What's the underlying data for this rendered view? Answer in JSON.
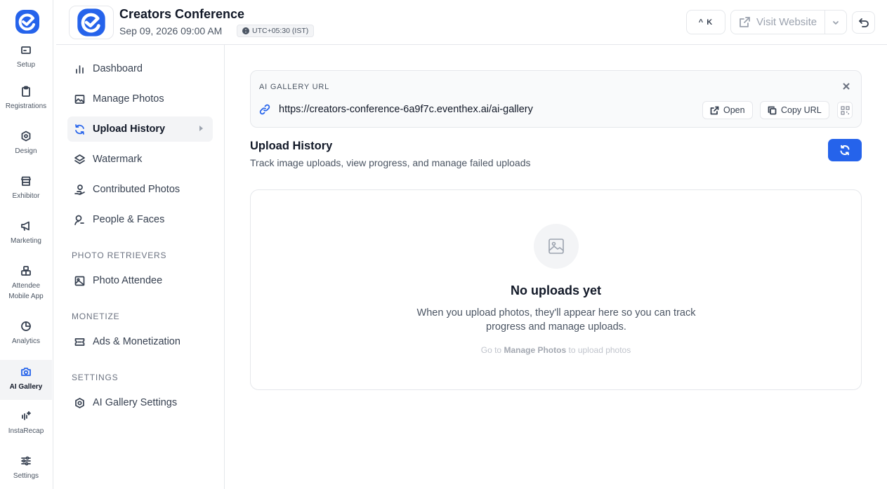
{
  "rail": {
    "items": [
      {
        "label": "Setup",
        "icon": "setup-icon"
      },
      {
        "label": "Registrations",
        "icon": "clipboard-icon"
      },
      {
        "label": "Design",
        "icon": "design-icon"
      },
      {
        "label": "Exhibitor",
        "icon": "store-icon"
      },
      {
        "label": "Marketing",
        "icon": "megaphone-icon"
      },
      {
        "label_line1": "Attendee",
        "label_line2": "Mobile App",
        "icon": "app-icon"
      },
      {
        "label": "Analytics",
        "icon": "pie-chart-icon"
      },
      {
        "label": "AI Gallery",
        "icon": "camera-icon",
        "active": true
      },
      {
        "label": "InstaRecap",
        "icon": "sparkle-audio-icon"
      },
      {
        "label": "Settings",
        "icon": "sliders-icon"
      }
    ]
  },
  "header": {
    "event_title": "Creators Conference",
    "event_date": "Sep 09, 2026 09:00 AM",
    "timezone": "UTC+05:30 (IST)",
    "shortcut_label": "^ K",
    "visit_label": "Visit Website"
  },
  "subnav": {
    "items": [
      {
        "label": "Dashboard",
        "icon": "bar-chart-icon"
      },
      {
        "label": "Manage Photos",
        "icon": "image-icon"
      },
      {
        "label": "Upload History",
        "icon": "refresh-icon",
        "active": true
      },
      {
        "label": "Watermark",
        "icon": "layers-icon"
      },
      {
        "label": "Contributed Photos",
        "icon": "hand-icon"
      },
      {
        "label": "People & Faces",
        "icon": "person-search-icon"
      }
    ],
    "section_retrievers": "PHOTO RETRIEVERS",
    "photo_attendee": "Photo Attendee",
    "section_monetize": "MONETIZE",
    "ads": "Ads & Monetization",
    "section_settings": "SETTINGS",
    "gallery_settings": "AI Gallery Settings"
  },
  "url_card": {
    "label": "AI GALLERY URL",
    "url": "https://creators-conference-6a9f7c.eventhex.ai/ai-gallery",
    "open_label": "Open",
    "copy_label": "Copy URL"
  },
  "main": {
    "title": "Upload History",
    "subtitle": "Track image uploads, view progress, and manage failed uploads"
  },
  "empty_state": {
    "title": "No uploads yet",
    "description": "When you upload photos, they'll appear here so you can track progress and manage uploads.",
    "hint_prefix": "Go to",
    "hint_link": "Manage Photos",
    "hint_suffix": "to upload photos"
  },
  "colors": {
    "accent": "#2563eb",
    "border": "#e5e7eb",
    "muted_text": "#4b5563"
  }
}
